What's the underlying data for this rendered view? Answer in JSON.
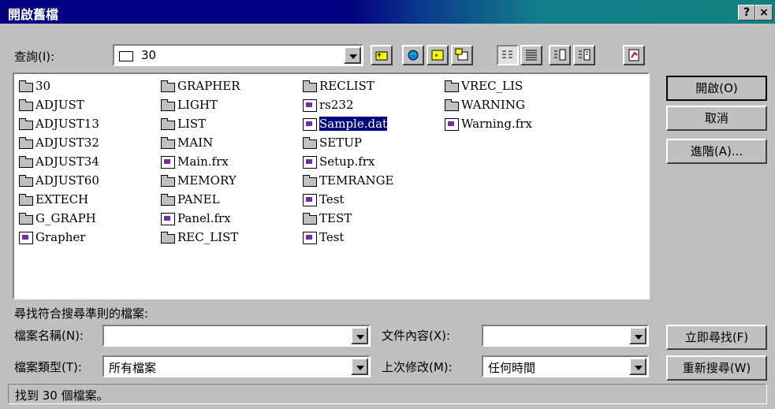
{
  "window": {
    "title": "開啟舊檔",
    "help_btn": "?",
    "close_btn": "×"
  },
  "lookin": {
    "label": "查詢(I):",
    "value": "30"
  },
  "toolbar": {
    "icons": [
      "up-folder-icon",
      "internet-icon",
      "favorites-icon",
      "add-favorite-icon",
      "list-view-icon",
      "details-view-icon",
      "properties-view-icon",
      "preview-view-icon",
      "commands-icon"
    ]
  },
  "files": [
    [
      "30",
      "folder"
    ],
    [
      "ADJUST",
      "folder"
    ],
    [
      "ADJUST13",
      "folder"
    ],
    [
      "ADJUST32",
      "folder"
    ],
    [
      "ADJUST34",
      "folder"
    ],
    [
      "ADJUST60",
      "folder"
    ],
    [
      "EXTECH",
      "folder"
    ],
    [
      "G_GRAPH",
      "folder"
    ],
    [
      "Grapher",
      "file"
    ],
    [
      "GRAPHER",
      "folder"
    ],
    [
      "LIGHT",
      "folder"
    ],
    [
      "LIST",
      "folder"
    ],
    [
      "MAIN",
      "folder"
    ],
    [
      "Main.frx",
      "frx"
    ],
    [
      "MEMORY",
      "folder"
    ],
    [
      "PANEL",
      "folder"
    ],
    [
      "Panel.frx",
      "frx"
    ],
    [
      "REC_LIST",
      "folder"
    ],
    [
      "RECLIST",
      "folder"
    ],
    [
      "rs232",
      "file"
    ],
    [
      "Sample.dat",
      "frx"
    ],
    [
      "SETUP",
      "folder"
    ],
    [
      "Setup.frx",
      "frx"
    ],
    [
      "TEMRANGE",
      "folder"
    ],
    [
      "Test",
      "frx"
    ],
    [
      "TEST",
      "folder"
    ],
    [
      "Test",
      "file"
    ],
    [
      "VREC_LIS",
      "folder"
    ],
    [
      "WARNING",
      "folder"
    ],
    [
      "Warning.frx",
      "frx"
    ]
  ],
  "selected_index": 20,
  "buttons": {
    "open": "開啟(O)",
    "cancel": "取消",
    "advanced": "進階(A)...",
    "find_now": "立即尋找(F)",
    "new_search": "重新搜尋(W)"
  },
  "search": {
    "heading": "尋找符合搜尋準則的檔案:",
    "filename_label": "檔案名稱(N):",
    "filename_value": "",
    "filetype_label": "檔案類型(T):",
    "filetype_value": "所有檔案",
    "content_label": "文件內容(X):",
    "content_value": "",
    "modified_label": "上次修改(M):",
    "modified_value": "任何時間"
  },
  "status": "找到 30 個檔案。"
}
